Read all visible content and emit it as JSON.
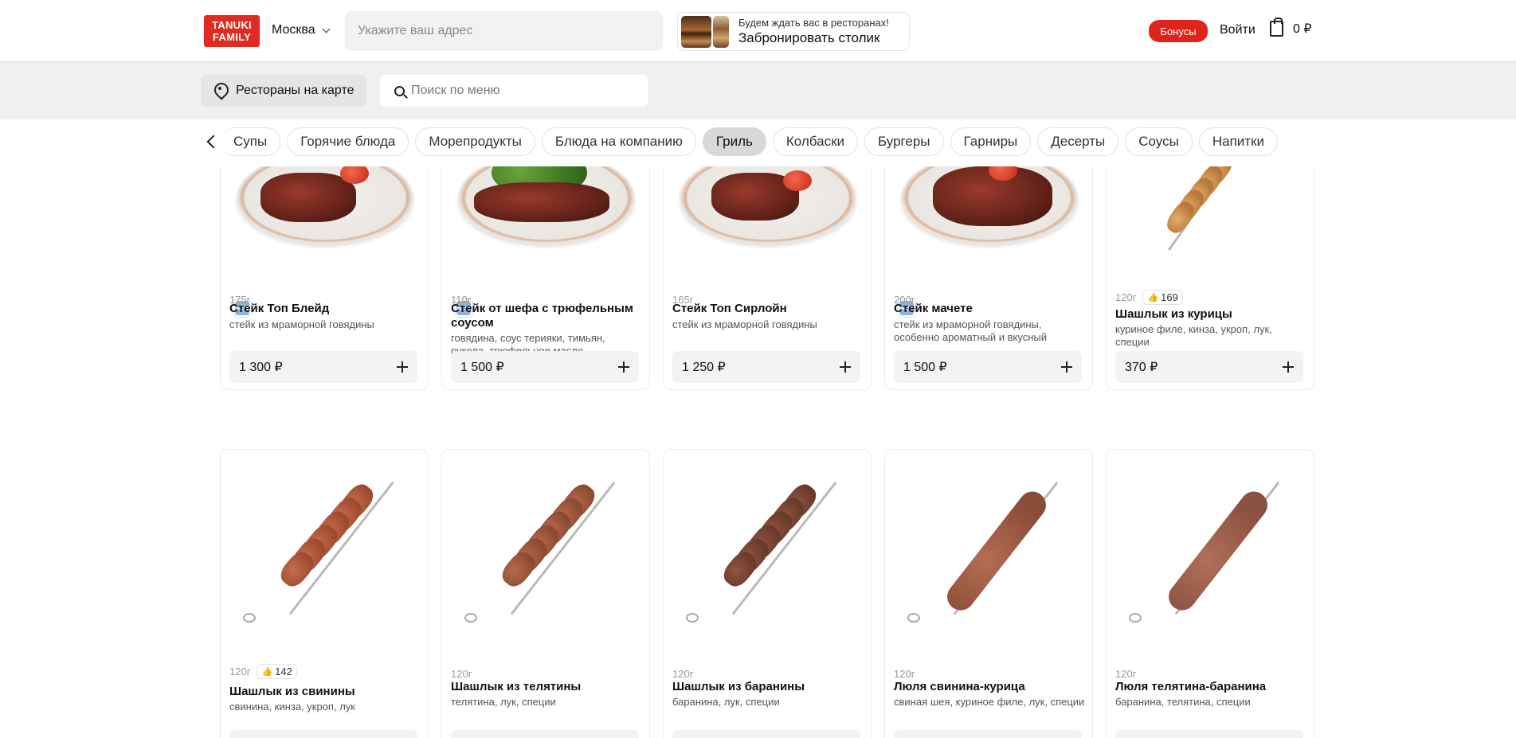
{
  "header": {
    "logo_line1": "TANUKI",
    "logo_line2": "FAMILY",
    "city": "Москва",
    "address_placeholder": "Укажите ваш адрес",
    "booking_small": "Будем ждать вас в ресторанах!",
    "booking_big": "Забронировать столик",
    "bonus_label": "Бонусы",
    "login_label": "Войти",
    "cart_total": "0 ₽"
  },
  "subbar": {
    "map_button": "Рестораны на карте",
    "search_placeholder": "Поиск по меню"
  },
  "categories": [
    "Супы",
    "Горячие блюда",
    "Морепродукты",
    "Блюда на компанию",
    "Гриль",
    "Колбаски",
    "Бургеры",
    "Гарниры",
    "Десерты",
    "Соусы",
    "Напитки"
  ],
  "active_category": "Гриль",
  "products_row1": [
    {
      "weight": "175г",
      "name": "Стейк Топ Блейд",
      "desc": "стейк из мраморной говядины",
      "price": "1 300 ₽",
      "badge": "NEW",
      "rating": null
    },
    {
      "weight": "110г",
      "name": "Стейк от шефа с трюфельным соусом",
      "desc": "говядина, соус терияки, тимьян, рукола, трюфельное масло",
      "price": "1 500 ₽",
      "badge": "NEW",
      "rating": null
    },
    {
      "weight": "165г",
      "name": "Стейк Топ Сирлойн",
      "desc": "стейк из мраморной говядины",
      "price": "1 250 ₽",
      "badge": null,
      "rating": null
    },
    {
      "weight": "200г",
      "name": "Стейк мачете",
      "desc": "стейк из мраморной говядины, особенно ароматный и вкусный",
      "price": "1 500 ₽",
      "badge": "NEW",
      "rating": null
    },
    {
      "weight": "120г",
      "name": "Шашлык из курицы",
      "desc": "куриное филе, кинза, укроп, лук, специи",
      "price": "370 ₽",
      "badge": null,
      "rating": "169"
    }
  ],
  "products_row2": [
    {
      "weight": "120г",
      "name": "Шашлык из свинины",
      "desc": "свинина, кинза, укроп, лук",
      "rating": "142"
    },
    {
      "weight": "120г",
      "name": "Шашлык из телятины",
      "desc": "телятина, лук, специи",
      "rating": null
    },
    {
      "weight": "120г",
      "name": "Шашлык из баранины",
      "desc": "баранина, лук, специи",
      "rating": null
    },
    {
      "weight": "120г",
      "name": "Люля свинина-курица",
      "desc": "свиная шея, куриное филе, лук, специи",
      "rating": null
    },
    {
      "weight": "120г",
      "name": "Люля телятина-баранина",
      "desc": "баранина, телятина, специи",
      "rating": null
    }
  ],
  "icons": {
    "location": "map-pin-icon",
    "search": "search-icon",
    "cart": "shopping-bag-icon",
    "back": "chevron-left-icon",
    "add": "plus-icon",
    "like": "thumbs-up-icon"
  },
  "colors": {
    "brand": "#e12a20",
    "active_chip": "#d9d8d6",
    "band": "#f1f0ee"
  }
}
